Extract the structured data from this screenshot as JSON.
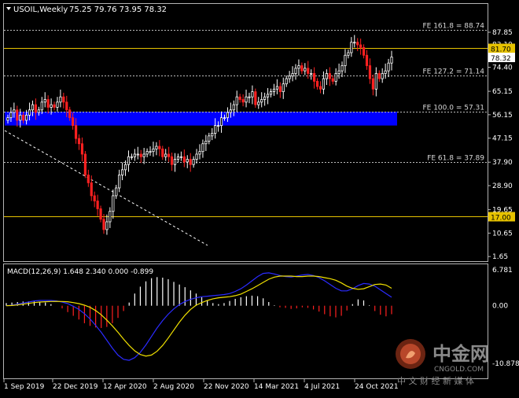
{
  "header": {
    "symbol": "USOIL,Weekly",
    "ohlc": "75.25 79.76 73.95 78.32"
  },
  "macd_header": "MACD(12,26,9) 1.648 2.340 0.000 -0.899",
  "watermark": {
    "brand": "中金网",
    "site": "CNGOLD.COM",
    "tagline": "中 文 财 经 新 媒 体"
  },
  "chart_data": [
    {
      "type": "candlestick",
      "title": "USOIL,Weekly",
      "y_ticks": [
        "87.85",
        "83.10",
        "74.40",
        "65.15",
        "56.15",
        "47.15",
        "37.90",
        "28.90",
        "19.65",
        "10.65",
        "1.65"
      ],
      "x_ticks": [
        "1 Sep 2019",
        "22 Dec 2019",
        "12 Apr 2020",
        "2 Aug 2020",
        "22 Nov 2020",
        "14 Mar 2021",
        "4 Jul 2021",
        "24 Oct 2021"
      ],
      "ylim": [
        1.65,
        91.5
      ],
      "last_price": 78.32,
      "horizontal_levels": [
        {
          "label": "FE 161.8 = 88.74",
          "value": 88.74,
          "style": "dotted"
        },
        {
          "label": "81.70",
          "value": 81.7,
          "style": "solid",
          "color": "#e6c200"
        },
        {
          "label": "FE 127.2 = 71.14",
          "value": 71.14,
          "style": "dotted"
        },
        {
          "label": "FE 100.0 = 57.31",
          "value": 57.31,
          "style": "dotted"
        },
        {
          "label": "FE 61.8 = 37.89",
          "value": 37.89,
          "style": "dotted"
        },
        {
          "label": "17.00",
          "value": 17.0,
          "style": "solid",
          "color": "#e6c200"
        }
      ],
      "zone": {
        "from": 52.0,
        "to": 57.31,
        "color": "#0000ff"
      },
      "close_series": [
        55,
        57,
        58,
        54,
        56,
        54,
        56,
        58,
        60,
        57,
        58,
        61,
        62,
        59,
        60,
        59,
        61,
        63,
        61,
        58,
        55,
        52,
        47,
        45,
        41,
        33,
        30,
        25,
        23,
        20,
        16,
        12,
        15,
        19,
        25,
        28,
        33,
        35,
        37,
        40,
        40,
        41,
        41,
        40,
        41,
        42,
        42,
        43,
        44,
        43,
        40,
        41,
        40,
        37,
        39,
        40,
        40,
        38,
        39,
        37,
        39,
        41,
        42,
        45,
        46,
        48,
        49,
        52,
        52,
        55,
        55,
        57,
        58,
        60,
        63,
        62,
        61,
        63,
        63,
        65,
        60,
        61,
        62,
        63,
        64,
        65,
        66,
        67,
        65,
        68,
        70,
        71,
        72,
        74,
        75,
        73,
        74,
        72,
        72,
        69,
        67,
        66,
        70,
        72,
        70,
        69,
        72,
        73,
        75,
        79,
        80,
        84,
        84,
        83,
        82,
        79,
        75,
        70,
        66,
        72,
        70,
        72,
        73,
        76,
        78.32
      ],
      "macd": {
        "ylim": [
          -10.878,
          6.781
        ],
        "y_ticks": [
          "6.781",
          "0.00",
          "-10.878"
        ],
        "signal": [
          0.0,
          0.05,
          0.15,
          0.3,
          0.45,
          0.6,
          0.7,
          0.75,
          0.8,
          0.82,
          0.8,
          0.75,
          0.6,
          0.4,
          0.1,
          -0.3,
          -0.9,
          -1.7,
          -2.7,
          -3.8,
          -5.0,
          -6.3,
          -7.5,
          -8.5,
          -9.2,
          -9.5,
          -9.3,
          -8.6,
          -7.5,
          -6.1,
          -4.6,
          -3.1,
          -1.8,
          -0.7,
          0.1,
          0.6,
          1.0,
          1.3,
          1.5,
          1.6,
          1.7,
          1.9,
          2.2,
          2.7,
          3.2,
          3.8,
          4.4,
          5.0,
          5.4,
          5.6,
          5.6,
          5.6,
          5.5,
          5.5,
          5.6,
          5.6,
          5.5,
          5.3,
          5.1,
          4.8,
          4.3,
          3.7,
          3.3,
          3.1,
          3.2,
          3.6,
          4.0,
          4.1,
          3.9,
          3.3
        ],
        "main": [
          0.0,
          0.1,
          0.3,
          0.5,
          0.7,
          0.9,
          1.0,
          1.0,
          1.0,
          0.9,
          0.7,
          0.4,
          -0.1,
          -0.7,
          -1.5,
          -2.5,
          -3.7,
          -5.0,
          -6.5,
          -8.0,
          -9.3,
          -10.1,
          -10.3,
          -9.8,
          -8.8,
          -7.4,
          -5.8,
          -4.2,
          -2.8,
          -1.6,
          -0.6,
          0.2,
          0.8,
          1.2,
          1.5,
          1.7,
          1.8,
          1.9,
          2.0,
          2.1,
          2.3,
          2.7,
          3.2,
          3.9,
          4.7,
          5.5,
          6.1,
          6.2,
          6.0,
          5.7,
          5.5,
          5.4,
          5.6,
          5.8,
          5.9,
          5.7,
          5.3,
          4.7,
          4.0,
          3.3,
          2.8,
          2.8,
          3.2,
          3.8,
          4.2,
          4.1,
          3.7,
          3.0,
          2.3,
          1.6
        ],
        "histogram": [
          0.5,
          0.6,
          0.7,
          0.8,
          0.8,
          0.8,
          0.7,
          0.6,
          0.3,
          0.0,
          -0.5,
          -1.2,
          -1.9,
          -2.6,
          -3.3,
          -3.8,
          -4.1,
          -4.2,
          -4.0,
          -3.3,
          -2.3,
          -1.0,
          0.6,
          2.3,
          3.6,
          4.6,
          5.2,
          5.4,
          5.3,
          5.0,
          4.5,
          4.0,
          3.5,
          2.9,
          2.3,
          1.6,
          1.0,
          0.5,
          0.3,
          0.5,
          0.9,
          1.3,
          1.6,
          1.8,
          1.9,
          1.8,
          1.4,
          0.7,
          0.1,
          -0.3,
          -0.4,
          -0.6,
          -0.5,
          -0.3,
          -0.4,
          -0.7,
          -1.1,
          -1.6,
          -2.0,
          -2.2,
          -1.9,
          -0.9,
          0.3,
          1.2,
          1.0,
          0.1,
          -1.0,
          -1.7,
          -2.0,
          -1.6
        ]
      }
    }
  ]
}
